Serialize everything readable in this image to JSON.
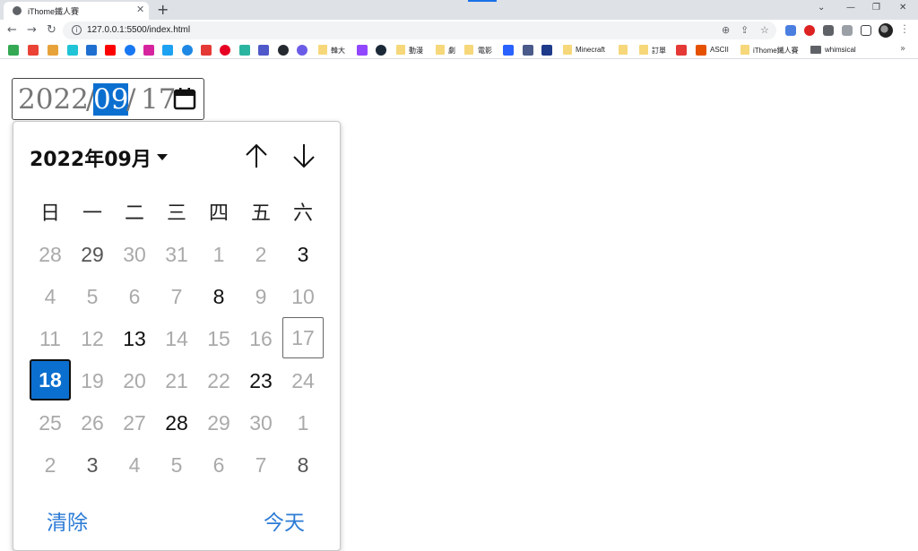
{
  "browser": {
    "tab_title": "iThome鐵人賽",
    "tab_close": "✕",
    "new_tab": "+",
    "window_controls": [
      "⌄",
      "—",
      "❐",
      "✕"
    ],
    "url": "127.0.0.1:5500/index.html",
    "bookmarks": [
      "韓大",
      "動漫",
      "劇",
      "電影",
      "Minecraft",
      "訂單",
      "ASCII",
      "iThome鐵人賽",
      "whimsical"
    ],
    "bookmarks_more": "»"
  },
  "date_input": {
    "year": "2022",
    "sep1": "/",
    "month": "09",
    "sep2": "/",
    "day": "17"
  },
  "picker": {
    "month_label": "2022年09月",
    "weekdays": [
      "日",
      "一",
      "二",
      "三",
      "四",
      "五",
      "六"
    ],
    "weeks": [
      [
        "28",
        "29",
        "30",
        "31",
        "1",
        "2",
        "3"
      ],
      [
        "4",
        "5",
        "6",
        "7",
        "8",
        "9",
        "10"
      ],
      [
        "11",
        "12",
        "13",
        "14",
        "15",
        "16",
        "17"
      ],
      [
        "18",
        "19",
        "20",
        "21",
        "22",
        "23",
        "24"
      ],
      [
        "25",
        "26",
        "27",
        "28",
        "29",
        "30",
        "1"
      ],
      [
        "2",
        "3",
        "4",
        "5",
        "6",
        "7",
        "8"
      ]
    ],
    "clear_label": "清除",
    "today_label": "今天",
    "accent_color": "#0b6fd0"
  }
}
